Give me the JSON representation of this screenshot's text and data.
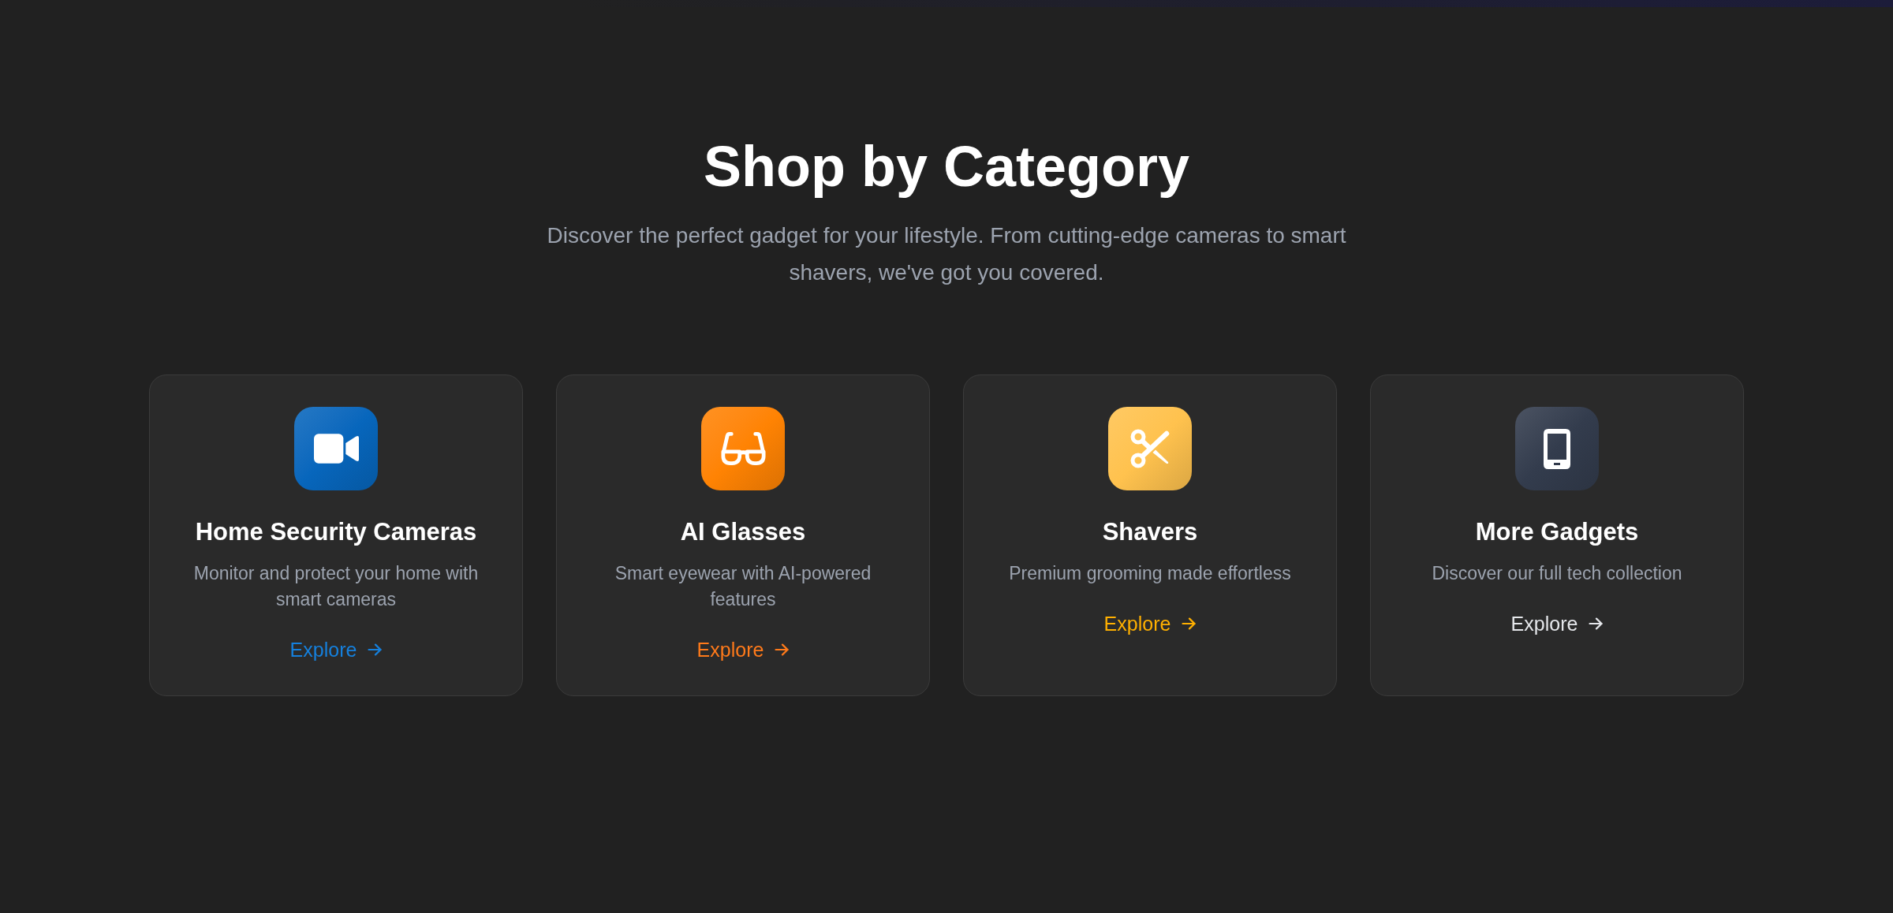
{
  "section": {
    "title": "Shop by Category",
    "subtitle": "Discover the perfect gadget for your lifestyle. From cutting-edge cameras to smart shavers, we've got you covered."
  },
  "categories": [
    {
      "title": "Home Security Cameras",
      "description": "Monitor and protect your home with smart cameras",
      "icon_tile": {
        "color": "#0766bc"
      },
      "link": {
        "label": "Explore",
        "color": "#1580dd"
      }
    },
    {
      "title": "AI Glasses",
      "description": "Smart eyewear with AI-powered features",
      "icon_tile": {
        "color": "#ff8303"
      },
      "link": {
        "label": "Explore",
        "color": "#ff7a1a"
      }
    },
    {
      "title": "Shavers",
      "description": "Premium grooming made effortless",
      "icon_tile": {
        "color": "#ffc24e"
      },
      "link": {
        "label": "Explore",
        "color": "#ffb000"
      }
    },
    {
      "title": "More Gadgets",
      "description": "Discover our full tech collection",
      "icon_tile": {
        "color": "#333c4d"
      },
      "link": {
        "label": "Explore",
        "color": "#e5e7eb"
      }
    }
  ]
}
